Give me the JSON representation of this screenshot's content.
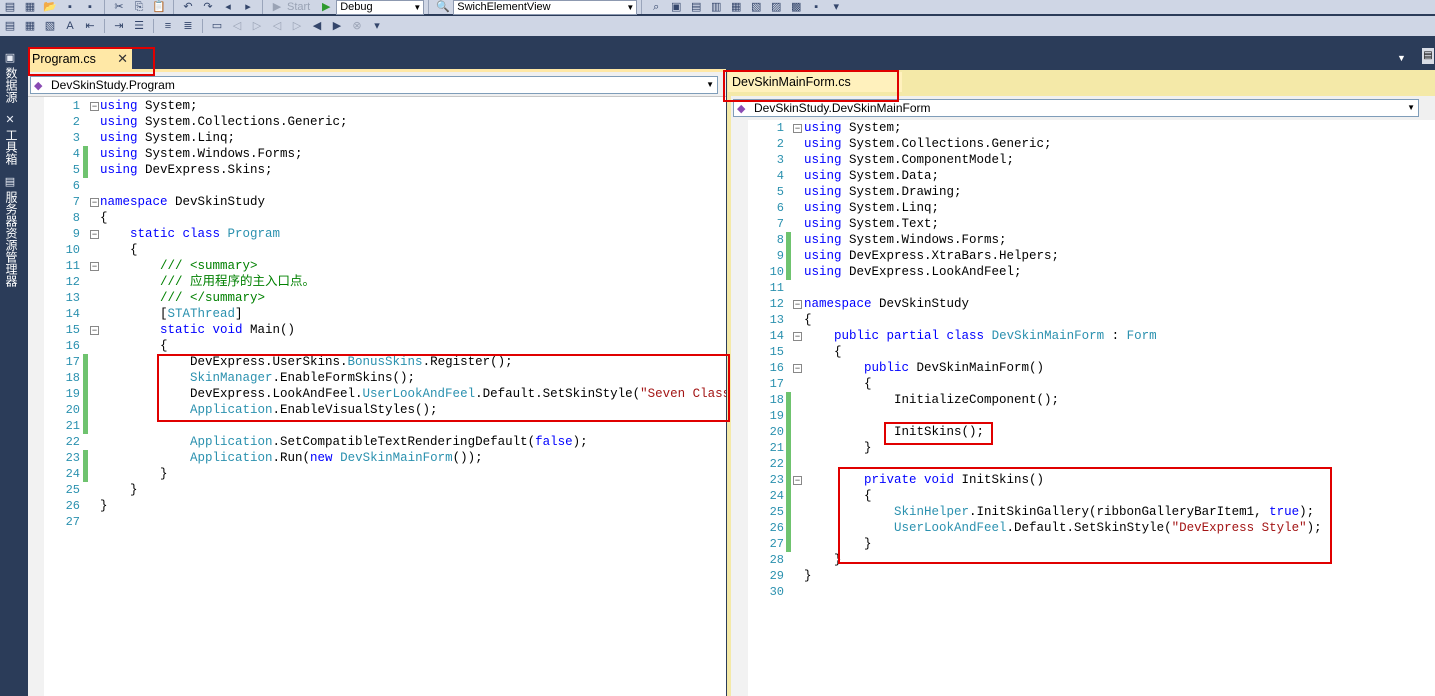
{
  "toolbar": {
    "start_label": "Start",
    "config_combo": "Debug",
    "project_combo": "SwichElementView"
  },
  "sidebar": {
    "tabs": [
      "数据源",
      "工具箱",
      "服务器资源管理器"
    ]
  },
  "left_pane": {
    "tab_label": "Program.cs",
    "nav_label": "DevSkinStudy.Program"
  },
  "right_pane": {
    "tab_label": "DevSkinMainForm.cs",
    "nav_label": "DevSkinStudy.DevSkinMainForm"
  },
  "left_code": [
    [
      [
        "kw",
        "using"
      ],
      [
        "pl",
        " System;"
      ]
    ],
    [
      [
        "kw",
        "using"
      ],
      [
        "pl",
        " System.Collections.Generic;"
      ]
    ],
    [
      [
        "kw",
        "using"
      ],
      [
        "pl",
        " System.Linq;"
      ]
    ],
    [
      [
        "kw",
        "using"
      ],
      [
        "pl",
        " System.Windows.Forms;"
      ]
    ],
    [
      [
        "kw",
        "using"
      ],
      [
        "pl",
        " DevExpress.Skins;"
      ]
    ],
    [],
    [
      [
        "kw",
        "namespace"
      ],
      [
        "pl",
        " DevSkinStudy"
      ]
    ],
    [
      [
        "pl",
        "{"
      ]
    ],
    [
      [
        "pl",
        "    "
      ],
      [
        "kw",
        "static class"
      ],
      [
        "pl",
        " "
      ],
      [
        "ty",
        "Program"
      ]
    ],
    [
      [
        "pl",
        "    {"
      ]
    ],
    [
      [
        "pl",
        "        "
      ],
      [
        "cm",
        "/// <summary>"
      ]
    ],
    [
      [
        "pl",
        "        "
      ],
      [
        "cm",
        "/// 应用程序的主入口点。"
      ]
    ],
    [
      [
        "pl",
        "        "
      ],
      [
        "cm",
        "/// </summary>"
      ]
    ],
    [
      [
        "pl",
        "        ["
      ],
      [
        "ty",
        "STAThread"
      ],
      [
        "pl",
        "]"
      ]
    ],
    [
      [
        "pl",
        "        "
      ],
      [
        "kw",
        "static void"
      ],
      [
        "pl",
        " Main()"
      ]
    ],
    [
      [
        "pl",
        "        {"
      ]
    ],
    [
      [
        "pl",
        "            DevExpress.UserSkins."
      ],
      [
        "ty",
        "BonusSkins"
      ],
      [
        "pl",
        ".Register();"
      ]
    ],
    [
      [
        "pl",
        "            "
      ],
      [
        "ty",
        "SkinManager"
      ],
      [
        "pl",
        ".EnableFormSkins();"
      ]
    ],
    [
      [
        "pl",
        "            DevExpress.LookAndFeel."
      ],
      [
        "ty",
        "UserLookAndFeel"
      ],
      [
        "pl",
        ".Default.SetSkinStyle("
      ],
      [
        "st",
        "\"Seven Classic\""
      ],
      [
        "pl",
        ");"
      ]
    ],
    [
      [
        "pl",
        "            "
      ],
      [
        "ty",
        "Application"
      ],
      [
        "pl",
        ".EnableVisualStyles();"
      ]
    ],
    [],
    [
      [
        "pl",
        "            "
      ],
      [
        "ty",
        "Application"
      ],
      [
        "pl",
        ".SetCompatibleTextRenderingDefault("
      ],
      [
        "kw",
        "false"
      ],
      [
        "pl",
        ");"
      ]
    ],
    [
      [
        "pl",
        "            "
      ],
      [
        "ty",
        "Application"
      ],
      [
        "pl",
        ".Run("
      ],
      [
        "kw",
        "new"
      ],
      [
        "pl",
        " "
      ],
      [
        "ty",
        "DevSkinMainForm"
      ],
      [
        "pl",
        "());"
      ]
    ],
    [
      [
        "pl",
        "        }"
      ]
    ],
    [
      [
        "pl",
        "    }"
      ]
    ],
    [
      [
        "pl",
        "}"
      ]
    ],
    []
  ],
  "right_code": [
    [
      [
        "kw",
        "using"
      ],
      [
        "pl",
        " System;"
      ]
    ],
    [
      [
        "kw",
        "using"
      ],
      [
        "pl",
        " System.Collections.Generic;"
      ]
    ],
    [
      [
        "kw",
        "using"
      ],
      [
        "pl",
        " System.ComponentModel;"
      ]
    ],
    [
      [
        "kw",
        "using"
      ],
      [
        "pl",
        " System.Data;"
      ]
    ],
    [
      [
        "kw",
        "using"
      ],
      [
        "pl",
        " System.Drawing;"
      ]
    ],
    [
      [
        "kw",
        "using"
      ],
      [
        "pl",
        " System.Linq;"
      ]
    ],
    [
      [
        "kw",
        "using"
      ],
      [
        "pl",
        " System.Text;"
      ]
    ],
    [
      [
        "kw",
        "using"
      ],
      [
        "pl",
        " System.Windows.Forms;"
      ]
    ],
    [
      [
        "kw",
        "using"
      ],
      [
        "pl",
        " DevExpress.XtraBars.Helpers;"
      ]
    ],
    [
      [
        "kw",
        "using"
      ],
      [
        "pl",
        " DevExpress.LookAndFeel;"
      ]
    ],
    [],
    [
      [
        "kw",
        "namespace"
      ],
      [
        "pl",
        " DevSkinStudy"
      ]
    ],
    [
      [
        "pl",
        "{"
      ]
    ],
    [
      [
        "pl",
        "    "
      ],
      [
        "kw",
        "public partial class"
      ],
      [
        "pl",
        " "
      ],
      [
        "ty",
        "DevSkinMainForm"
      ],
      [
        "pl",
        " : "
      ],
      [
        "ty",
        "Form"
      ]
    ],
    [
      [
        "pl",
        "    {"
      ]
    ],
    [
      [
        "pl",
        "        "
      ],
      [
        "kw",
        "public"
      ],
      [
        "pl",
        " DevSkinMainForm()"
      ]
    ],
    [
      [
        "pl",
        "        {"
      ]
    ],
    [
      [
        "pl",
        "            InitializeComponent();"
      ]
    ],
    [],
    [
      [
        "pl",
        "            InitSkins();"
      ]
    ],
    [
      [
        "pl",
        "        }"
      ]
    ],
    [],
    [
      [
        "pl",
        "        "
      ],
      [
        "kw",
        "private void"
      ],
      [
        "pl",
        " InitSkins()"
      ]
    ],
    [
      [
        "pl",
        "        {"
      ]
    ],
    [
      [
        "pl",
        "            "
      ],
      [
        "ty",
        "SkinHelper"
      ],
      [
        "pl",
        ".InitSkinGallery(ribbonGalleryBarItem1, "
      ],
      [
        "kw",
        "true"
      ],
      [
        "pl",
        ");"
      ]
    ],
    [
      [
        "pl",
        "            "
      ],
      [
        "ty",
        "UserLookAndFeel"
      ],
      [
        "pl",
        ".Default.SetSkinStyle("
      ],
      [
        "st",
        "\"DevExpress Style\""
      ],
      [
        "pl",
        ");"
      ]
    ],
    [
      [
        "pl",
        "        }"
      ]
    ],
    [
      [
        "pl",
        "    }"
      ]
    ],
    [
      [
        "pl",
        "}"
      ]
    ],
    []
  ]
}
